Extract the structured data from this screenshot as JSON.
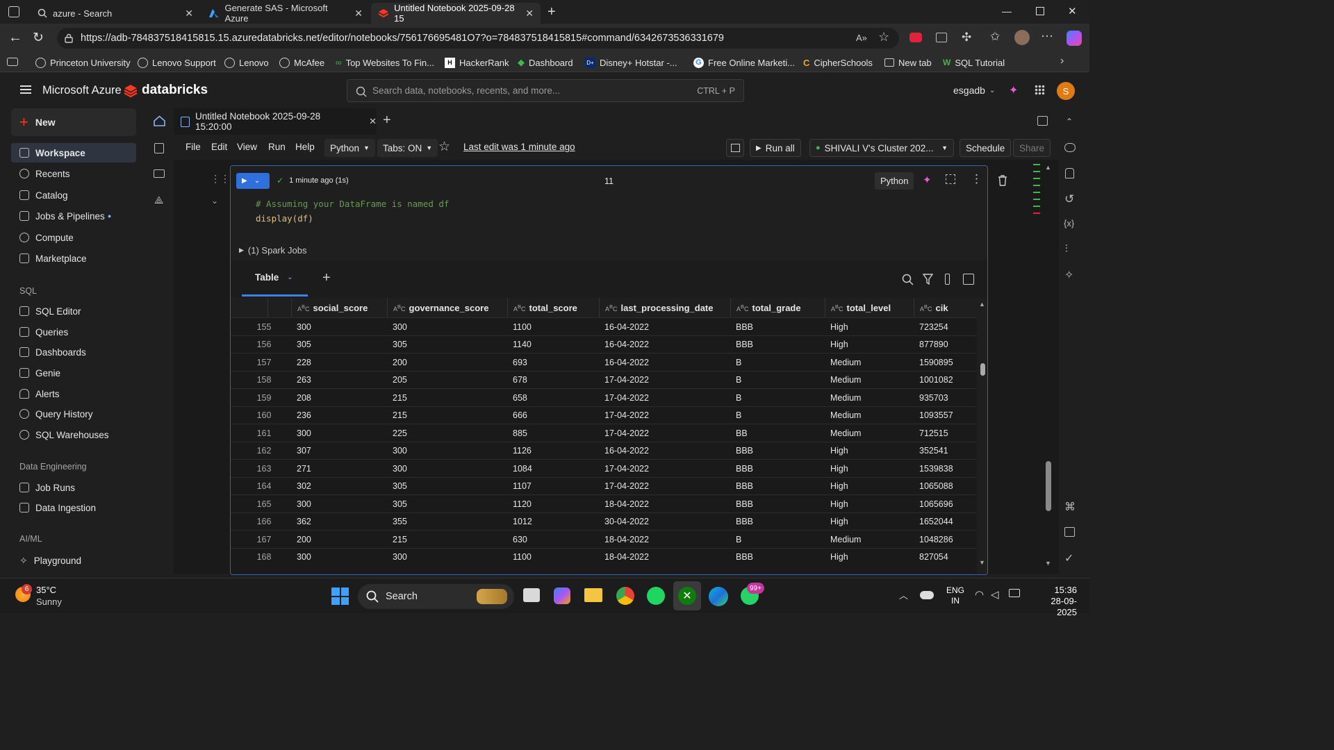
{
  "browser": {
    "tabs": [
      {
        "label": "azure - Search"
      },
      {
        "label": "Generate SAS - Microsoft Azure"
      },
      {
        "label": "Untitled Notebook 2025-09-28 15"
      }
    ],
    "url": "https://adb-784837518415815.15.azuredatabricks.net/editor/notebooks/756176695481O7?o=784837518415815#command/6342673536331679",
    "bookmarks": [
      "Princeton University",
      "Lenovo Support",
      "Lenovo",
      "McAfee",
      "Top Websites To Fin...",
      "HackerRank",
      "Dashboard",
      "Disney+ Hotstar -...",
      "Free Online Marketi...",
      "CipherSchools",
      "New tab",
      "SQL Tutorial"
    ]
  },
  "header": {
    "brand_azure": "Microsoft Azure",
    "brand_db": "databricks",
    "search_placeholder": "Search data, notebooks, recents, and more...",
    "search_shortcut": "CTRL + P",
    "workspace": "esgadb",
    "avatar": "S"
  },
  "sidebar": {
    "new_label": "New",
    "items": [
      "Workspace",
      "Recents",
      "Catalog",
      "Jobs & Pipelines",
      "Compute",
      "Marketplace"
    ],
    "sql_header": "SQL",
    "sql_items": [
      "SQL Editor",
      "Queries",
      "Dashboards",
      "Genie",
      "Alerts",
      "Query History",
      "SQL Warehouses"
    ],
    "de_header": "Data Engineering",
    "de_items": [
      "Job Runs",
      "Data Ingestion"
    ],
    "ml_header": "AI/ML",
    "ml_items": [
      "Playground"
    ]
  },
  "notebook": {
    "tab_title": "Untitled Notebook 2025-09-28 15:20:00",
    "menu": [
      "File",
      "Edit",
      "View",
      "Run",
      "Help"
    ],
    "language": "Python",
    "tabs_setting": "Tabs: ON",
    "last_edit": "Last edit was 1 minute ago",
    "run_all": "Run all",
    "cluster": "SHIVALI V's Cluster 202...",
    "schedule": "Schedule",
    "share": "Share"
  },
  "cell": {
    "status": "1 minute ago (1s)",
    "cell_number": "11",
    "lang_badge": "Python",
    "code_comment": "# Assuming your DataFrame is named df",
    "code_line": "display(df)",
    "spark_jobs": "(1) Spark Jobs",
    "result_tab": "Table"
  },
  "table": {
    "columns": [
      "social_score",
      "governance_score",
      "total_score",
      "last_processing_date",
      "total_grade",
      "total_level",
      "cik"
    ],
    "rows": [
      [
        "155",
        "300",
        "300",
        "1100",
        "16-04-2022",
        "BBB",
        "High",
        "723254"
      ],
      [
        "156",
        "305",
        "305",
        "1140",
        "16-04-2022",
        "BBB",
        "High",
        "877890"
      ],
      [
        "157",
        "228",
        "200",
        "693",
        "16-04-2022",
        "B",
        "Medium",
        "1590895"
      ],
      [
        "158",
        "263",
        "205",
        "678",
        "17-04-2022",
        "B",
        "Medium",
        "1001082"
      ],
      [
        "159",
        "208",
        "215",
        "658",
        "17-04-2022",
        "B",
        "Medium",
        "935703"
      ],
      [
        "160",
        "236",
        "215",
        "666",
        "17-04-2022",
        "B",
        "Medium",
        "1093557"
      ],
      [
        "161",
        "300",
        "225",
        "885",
        "17-04-2022",
        "BB",
        "Medium",
        "712515"
      ],
      [
        "162",
        "307",
        "300",
        "1126",
        "16-04-2022",
        "BBB",
        "High",
        "352541"
      ],
      [
        "163",
        "271",
        "300",
        "1084",
        "17-04-2022",
        "BBB",
        "High",
        "1539838"
      ],
      [
        "164",
        "302",
        "305",
        "1107",
        "17-04-2022",
        "BBB",
        "High",
        "1065088"
      ],
      [
        "165",
        "300",
        "305",
        "1120",
        "18-04-2022",
        "BBB",
        "High",
        "1065696"
      ],
      [
        "166",
        "362",
        "355",
        "1012",
        "30-04-2022",
        "BBB",
        "High",
        "1652044"
      ],
      [
        "167",
        "200",
        "215",
        "630",
        "18-04-2022",
        "B",
        "Medium",
        "1048286"
      ],
      [
        "168",
        "300",
        "300",
        "1100",
        "18-04-2022",
        "BBB",
        "High",
        "827054"
      ]
    ]
  },
  "taskbar": {
    "weather_temp": "35°C",
    "weather_desc": "Sunny",
    "weather_badge": "6",
    "search_label": "Search",
    "whatsapp_badge": "99+",
    "lang1": "ENG",
    "lang2": "IN",
    "time": "15:36",
    "date": "28-09-2025"
  },
  "colors": {
    "accent": "#ff3621",
    "selected": "#2e3540",
    "cell_border": "#3b5fb0",
    "link": "#8ab4f8"
  }
}
